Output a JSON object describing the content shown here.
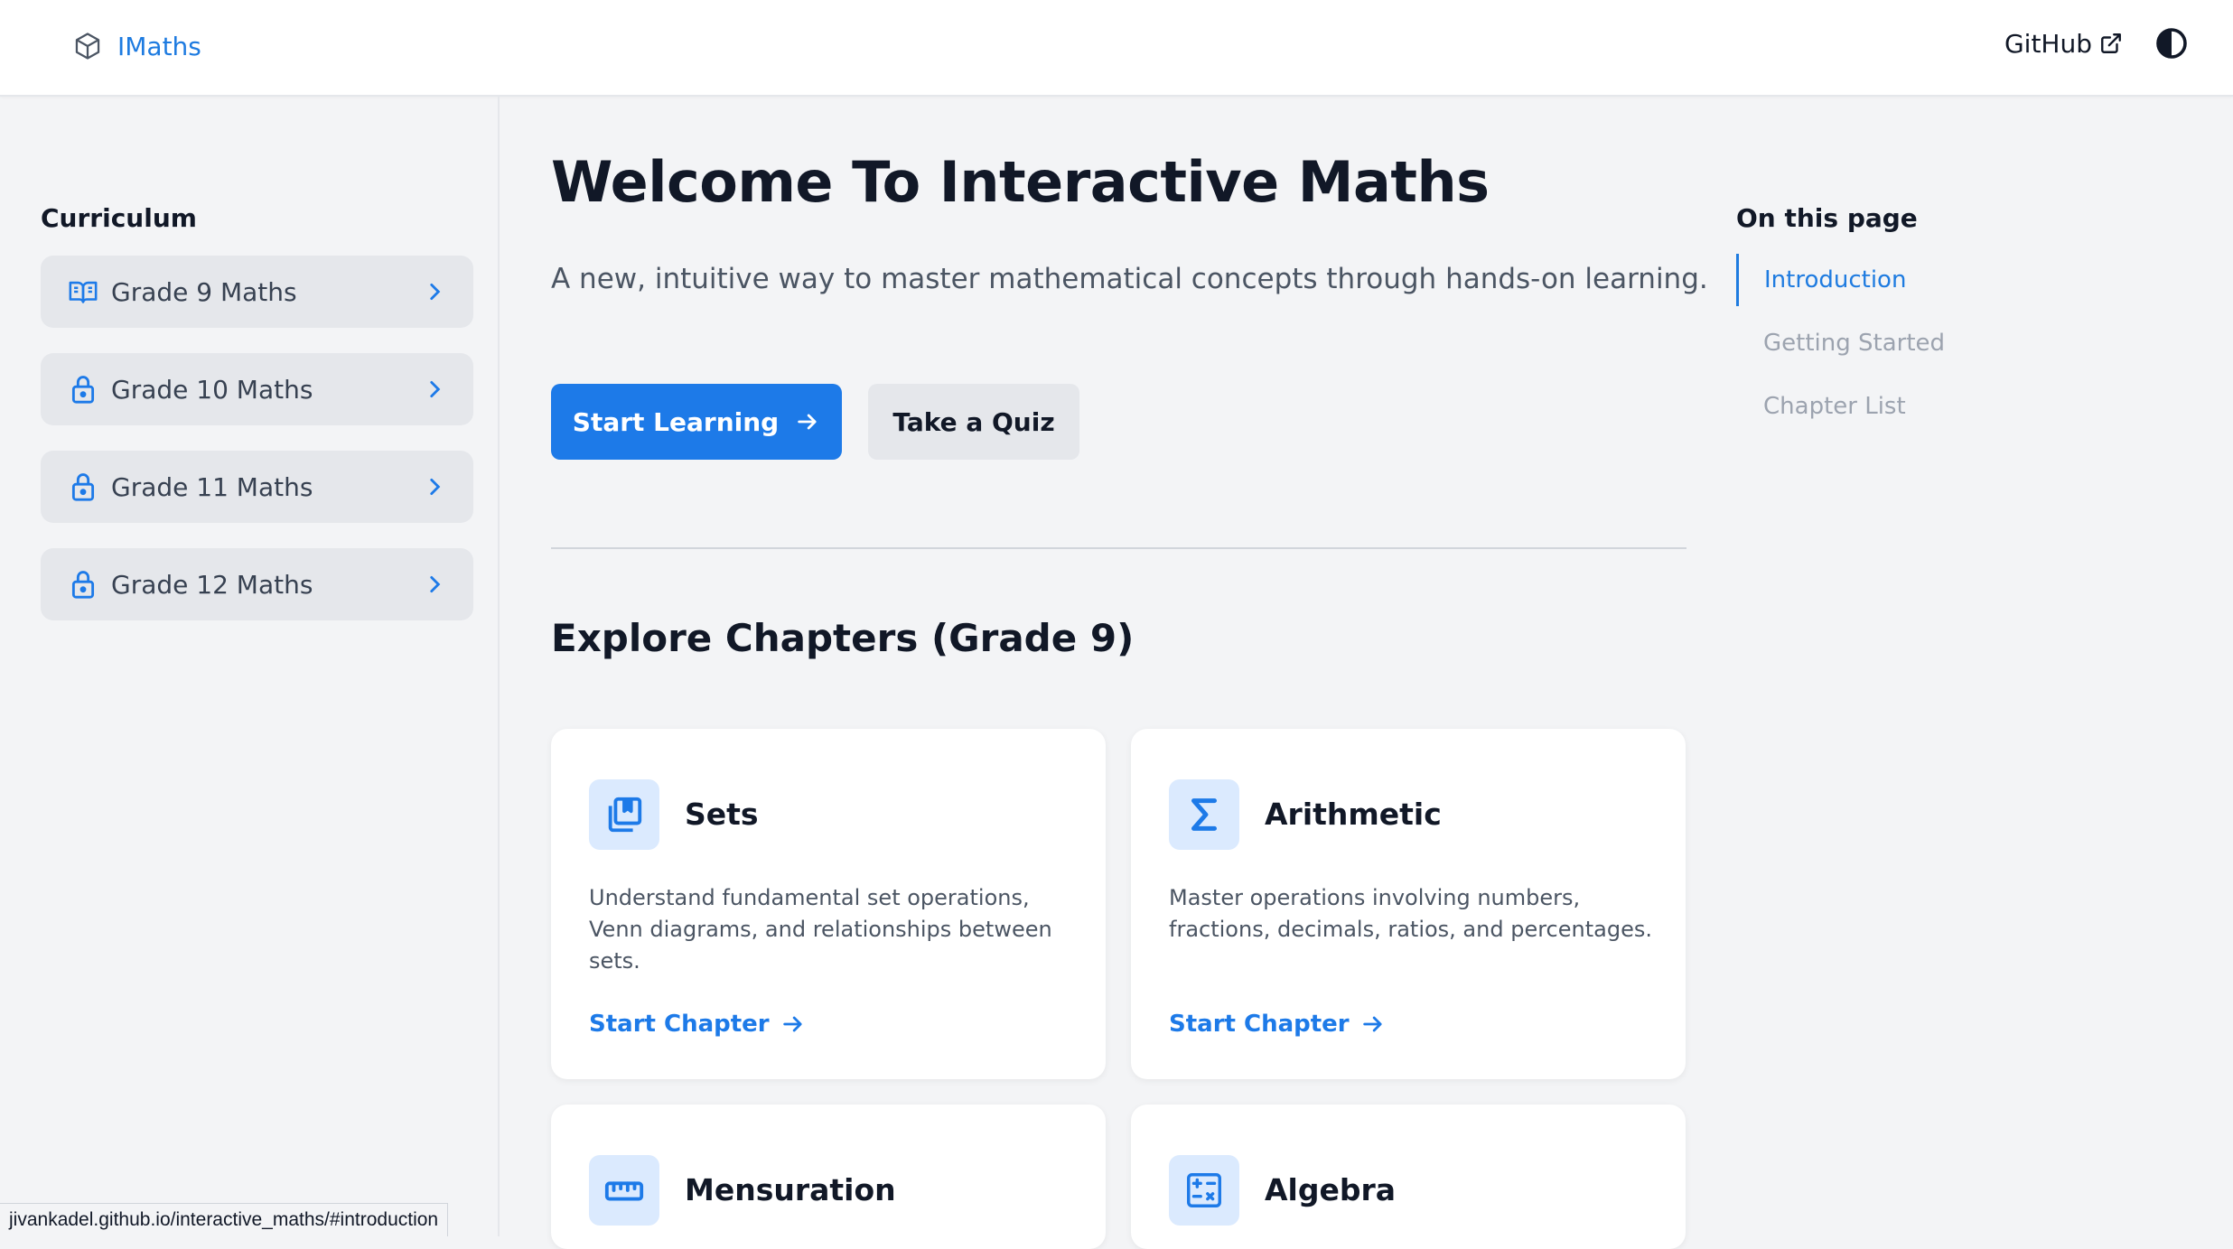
{
  "header": {
    "logo_icon": "cube-icon",
    "app_name": "IMaths",
    "github_label": "GitHub",
    "github_icon": "external-link-icon",
    "theme_icon": "contrast-icon"
  },
  "sidebar": {
    "title": "Curriculum",
    "items": [
      {
        "label": "Grade 9 Maths",
        "icon": "book-open-icon"
      },
      {
        "label": "Grade 10 Maths",
        "icon": "lock-icon"
      },
      {
        "label": "Grade 11 Maths",
        "icon": "lock-icon"
      },
      {
        "label": "Grade 12 Maths",
        "icon": "lock-icon"
      }
    ]
  },
  "main": {
    "title": "Welcome To Interactive Maths",
    "subtitle": "A new, intuitive way to master mathematical concepts through hands-on learning.",
    "primary_button": "Start Learning",
    "secondary_button": "Take a Quiz",
    "section_title": "Explore Chapters (Grade 9)",
    "chapters": [
      {
        "title": "Sets",
        "icon": "library-icon",
        "description": "Understand fundamental set operations, Venn diagrams, and relationships between sets.",
        "link": "Start Chapter"
      },
      {
        "title": "Arithmetic",
        "icon": "sigma-icon",
        "description": "Master operations involving numbers, fractions, decimals, ratios, and percentages.",
        "link": "Start Chapter"
      },
      {
        "title": "Mensuration",
        "icon": "ruler-icon",
        "description": "",
        "link": ""
      },
      {
        "title": "Algebra",
        "icon": "calculator-icon",
        "description": "",
        "link": ""
      }
    ]
  },
  "toc": {
    "title": "On this page",
    "items": [
      "Introduction",
      "Getting Started",
      "Chapter List"
    ],
    "active_index": 0
  },
  "statusbar": {
    "url": "jivankadel.github.io/interactive_maths/#introduction"
  },
  "colors": {
    "accent": "#1d7ae8",
    "link": "#1e7be0",
    "icon_bg": "#dbeafe",
    "page_bg": "#f3f4f6"
  }
}
